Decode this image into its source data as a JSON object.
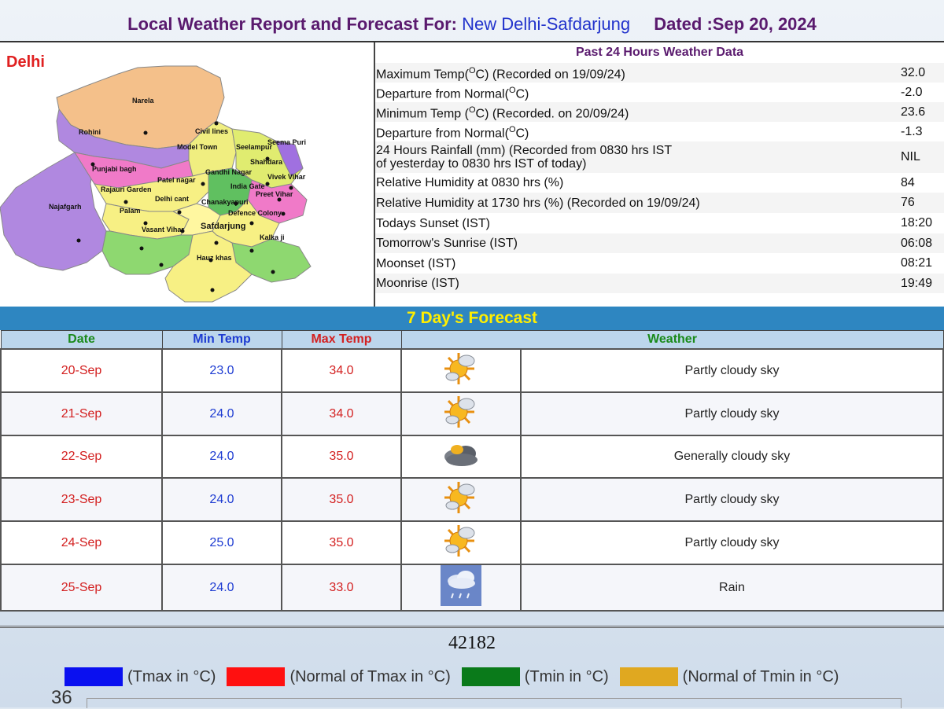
{
  "header": {
    "prefix": "Local Weather Report and Forecast For:",
    "city": "New Delhi-Safdarjung",
    "dated": "Dated :Sep 20, 2024"
  },
  "map": {
    "title": "Delhi",
    "places": [
      "Narela",
      "Rohini",
      "Civil lines",
      "Model Town",
      "Seelampur",
      "Seema Puri",
      "Shahdara",
      "Vivek Vihar",
      "Punjabi bagh",
      "Patel nagar",
      "Gandhi Nagar",
      "Rajauri Garden",
      "India Gate",
      "Preet Vihar",
      "Najafgarh",
      "Delhi cant",
      "Chanakyapuri",
      "Palam",
      "Defence Colony",
      "Vasant Vihar",
      "Safdarjung",
      "Kalka ji",
      "Hauz khas"
    ]
  },
  "past24": {
    "title": "Past 24 Hours Weather Data",
    "rows": [
      {
        "label_a": "Maximum Temp(",
        "sup": "O",
        "label_b": "C) (Recorded on 19/09/24)",
        "value": "32.0"
      },
      {
        "label_a": "Departure from Normal(",
        "sup": "O",
        "label_b": "C)",
        "value": "-2.0"
      },
      {
        "label_a": "Minimum Temp (",
        "sup": "O",
        "label_b": "C) (Recorded. on 20/09/24)",
        "value": "23.6"
      },
      {
        "label_a": "Departure from Normal(",
        "sup": "O",
        "label_b": "C)",
        "value": "-1.3"
      },
      {
        "label_a": "24 Hours Rainfall (mm) (Recorded from 0830 hrs IST",
        "label_c": "of yesterday to 0830 hrs IST of today)",
        "value": "NIL"
      },
      {
        "label_a": "Relative Humidity at 0830 hrs (%)",
        "value": "84"
      },
      {
        "label_a": "Relative Humidity at 1730 hrs (%) (Recorded on 19/09/24)",
        "value": "76"
      },
      {
        "label_a": "Todays Sunset (IST)",
        "value": "18:20"
      },
      {
        "label_a": "Tomorrow's Sunrise (IST)",
        "value": "06:08"
      },
      {
        "label_a": "Moonset (IST)",
        "value": "08:21"
      },
      {
        "label_a": "Moonrise (IST)",
        "value": "19:49"
      }
    ]
  },
  "forecast": {
    "title": "7 Day's Forecast",
    "headers": {
      "date": "Date",
      "min": "Min Temp",
      "max": "Max Temp",
      "weather": "Weather"
    },
    "rows": [
      {
        "date": "20-Sep",
        "min": "23.0",
        "max": "34.0",
        "icon": "partly-cloudy-icon",
        "weather": "Partly cloudy sky"
      },
      {
        "date": "21-Sep",
        "min": "24.0",
        "max": "34.0",
        "icon": "partly-cloudy-icon",
        "weather": "Partly cloudy sky"
      },
      {
        "date": "22-Sep",
        "min": "24.0",
        "max": "35.0",
        "icon": "cloudy-icon",
        "weather": "Generally cloudy sky"
      },
      {
        "date": "23-Sep",
        "min": "24.0",
        "max": "35.0",
        "icon": "partly-cloudy-icon",
        "weather": "Partly cloudy sky"
      },
      {
        "date": "24-Sep",
        "min": "25.0",
        "max": "35.0",
        "icon": "partly-cloudy-icon",
        "weather": "Partly cloudy sky"
      },
      {
        "date": "25-Sep",
        "min": "24.0",
        "max": "33.0",
        "icon": "rain-icon",
        "weather": "Rain"
      }
    ]
  },
  "station_code": "42182",
  "legend": [
    {
      "label": "(Tmax in °C)",
      "color": "#0a10f0"
    },
    {
      "label": "(Normal of Tmax in °C)",
      "color": "#ff1010"
    },
    {
      "label": "(Tmin in °C)",
      "color": "#0a7a1a"
    },
    {
      "label": "(Normal of Tmin in °C)",
      "color": "#e0a820"
    }
  ],
  "page_number": "36"
}
